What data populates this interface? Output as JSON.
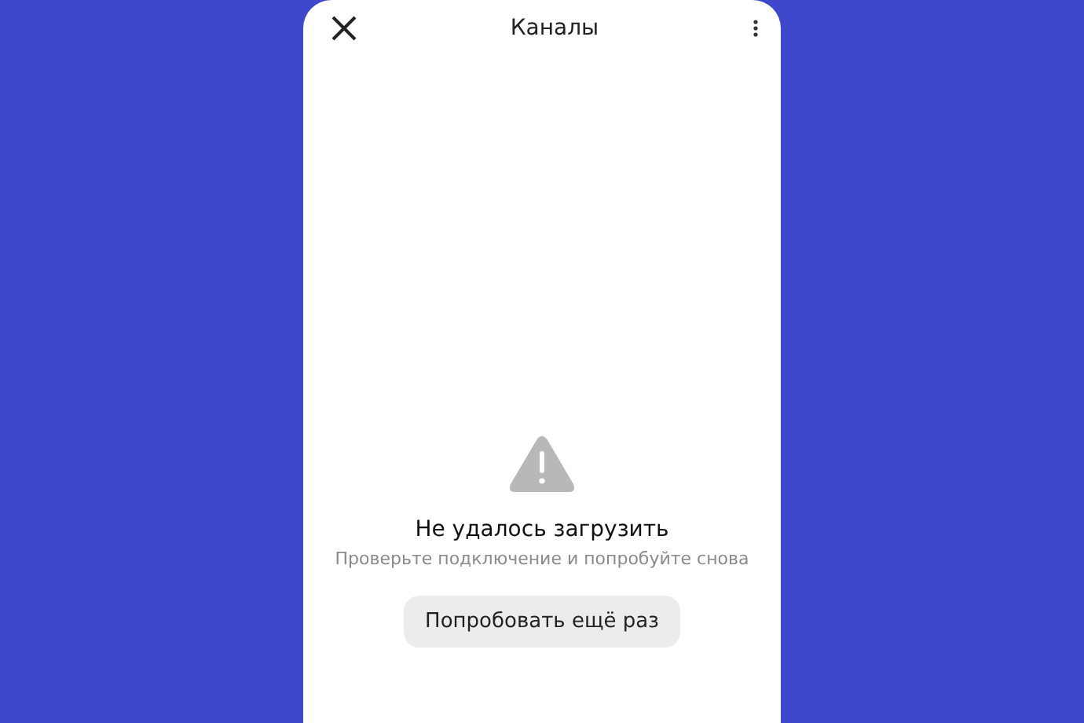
{
  "header": {
    "title": "Каналы"
  },
  "error": {
    "title": "Не удалось загрузить",
    "message": "Проверьте подключение и попробуйте снова",
    "button": "Попробовать ещё раз"
  }
}
